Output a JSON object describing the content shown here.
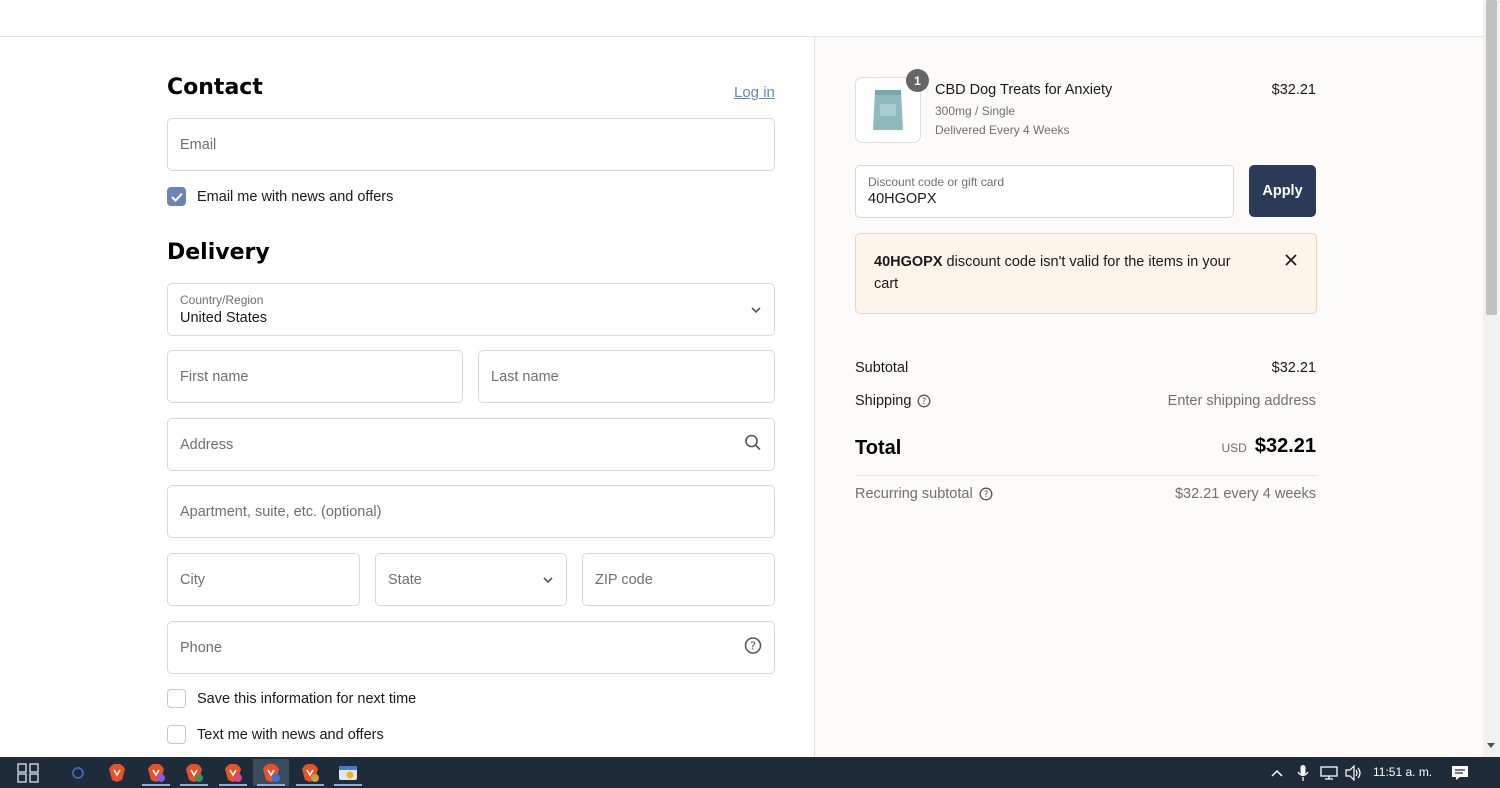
{
  "contact": {
    "title": "Contact",
    "login_link": "Log in",
    "email_placeholder": "Email",
    "newsletter_label": "Email me with news and offers"
  },
  "delivery": {
    "title": "Delivery",
    "country_label": "Country/Region",
    "country_value": "United States",
    "first_name_placeholder": "First name",
    "last_name_placeholder": "Last name",
    "address_placeholder": "Address",
    "apartment_placeholder": "Apartment, suite, etc. (optional)",
    "city_placeholder": "City",
    "state_placeholder": "State",
    "zip_placeholder": "ZIP code",
    "phone_placeholder": "Phone",
    "save_info_label": "Save this information for next time",
    "text_offers_label": "Text me with news and offers"
  },
  "summary": {
    "product": {
      "quantity": "1",
      "name": "CBD Dog Treats for Anxiety",
      "variant": "300mg / Single",
      "delivery": "Delivered Every 4 Weeks",
      "price": "$32.21"
    },
    "discount": {
      "label": "Discount code or gift card",
      "value": "40HGOPX",
      "apply_label": "Apply"
    },
    "alert": {
      "code": "40HGOPX",
      "message": " discount code isn't valid for the items in your cart"
    },
    "subtotal_label": "Subtotal",
    "subtotal_value": "$32.21",
    "shipping_label": "Shipping",
    "shipping_value": "Enter shipping address",
    "total_label": "Total",
    "total_currency": "USD",
    "total_value": "$32.21",
    "recurring_label": "Recurring subtotal",
    "recurring_value": "$32.21 every 4 weeks"
  },
  "taskbar": {
    "clock": "11:51 a. m."
  },
  "colors": {
    "accent": "#6b86b4",
    "apply_button": "#2a3a58",
    "alert_bg": "#fff4ea",
    "alert_border": "#f3d2b6",
    "taskbar": "#1d2b3a"
  }
}
